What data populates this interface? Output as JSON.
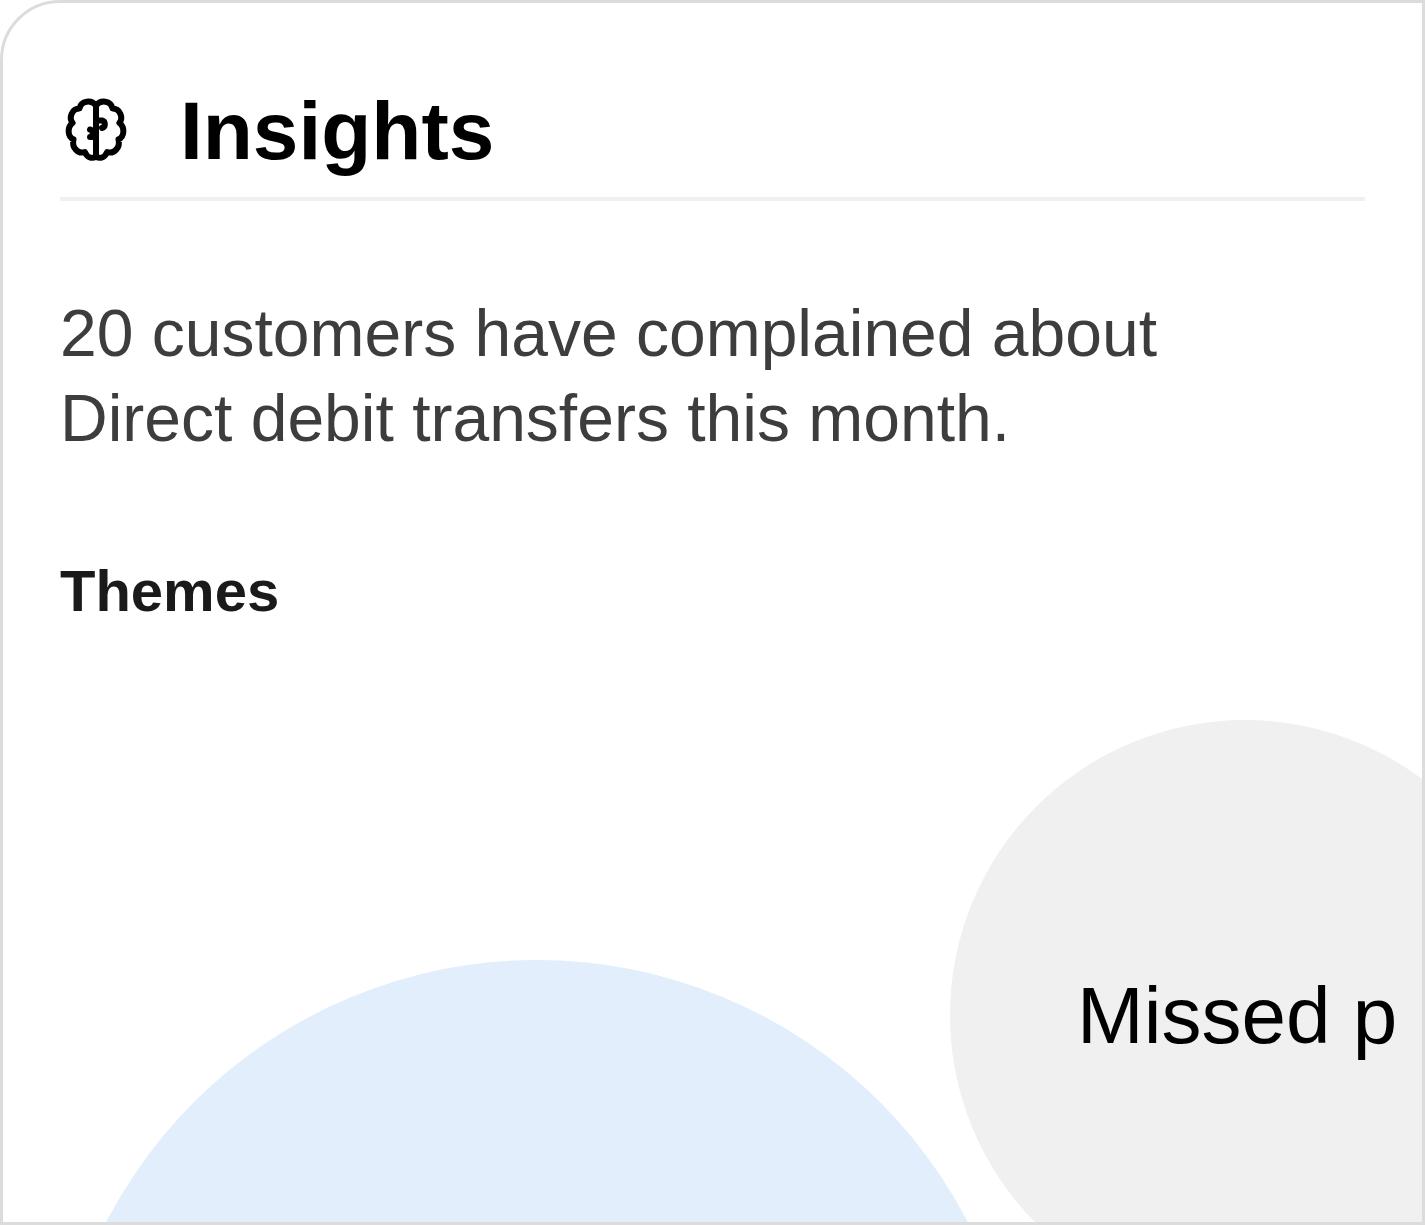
{
  "card": {
    "title": "Insights",
    "summary": "20 customers have complained about Direct debit transfers this month.",
    "themes_heading": "Themes",
    "themes": [
      {
        "color": "#e2eefc"
      },
      {
        "label": "Missed p",
        "color": "#f0f0f0"
      }
    ]
  }
}
